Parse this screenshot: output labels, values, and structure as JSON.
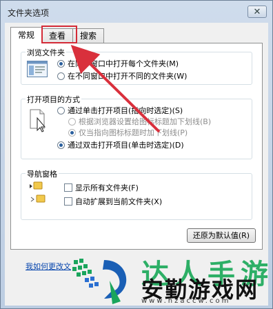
{
  "window": {
    "title": "文件夹选项"
  },
  "tabs": [
    {
      "label": "常规"
    },
    {
      "label": "查看"
    },
    {
      "label": "搜索"
    }
  ],
  "browse_folders": {
    "label": "浏览文件夹",
    "options": [
      {
        "label": "在同一窗口中打开每个文件夹(M)",
        "checked": true
      },
      {
        "label": "在不同窗口中打开不同的文件夹(W)",
        "checked": false
      }
    ]
  },
  "open_items": {
    "label": "打开项目的方式",
    "options": [
      {
        "label": "通过单击打开项目(指向时选定)(S)",
        "checked": false
      },
      {
        "label": "根据浏览器设置给图标标题加下划线(B)",
        "checked": false,
        "disabled": true
      },
      {
        "label": "仅当指向图标标题时加下划线(P)",
        "checked": true,
        "disabled": true
      },
      {
        "label": "通过双击打开项目(单击时选定)(D)",
        "checked": true
      }
    ]
  },
  "navigation_pane": {
    "label": "导航窗格",
    "options": [
      {
        "label": "显示所有文件夹(F)",
        "checked": false
      },
      {
        "label": "自动扩展到当前文件夹(X)",
        "checked": false
      }
    ]
  },
  "restore_button": {
    "label": "还原为默认值(R)"
  },
  "help_link": {
    "label": "我如何更改文"
  },
  "watermark": {
    "top_text": "达人手游",
    "main_text": "安勤游戏网",
    "url": "www.hzaccw.com"
  },
  "colors": {
    "highlight": "#d42a36",
    "watermark_green": "#18a858"
  }
}
